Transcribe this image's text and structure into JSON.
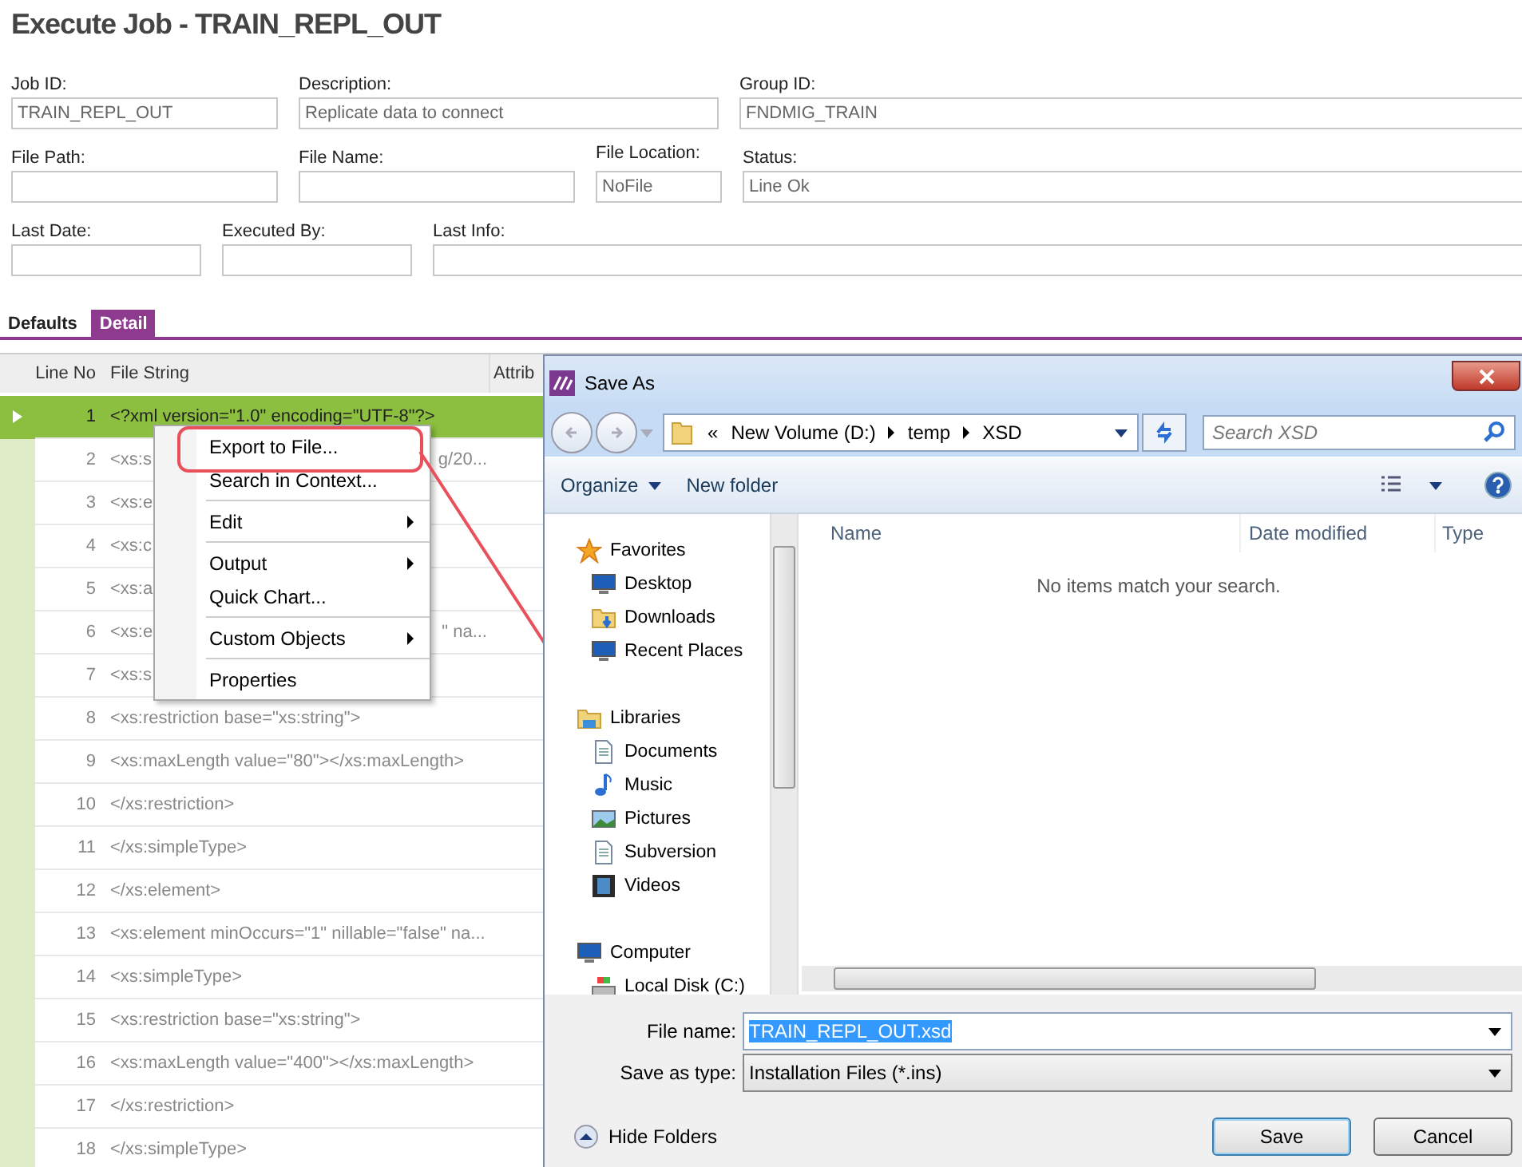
{
  "page": {
    "title": "Execute Job - TRAIN_REPL_OUT"
  },
  "form": {
    "fields": [
      {
        "label": "Job ID:",
        "value": "TRAIN_REPL_OUT"
      },
      {
        "label": "Description:",
        "value": "Replicate data to connect"
      },
      {
        "label": "Group ID:",
        "value": "FNDMIG_TRAIN"
      },
      {
        "label": "File Path:"
      },
      {
        "label": "File Name:"
      },
      {
        "label": "File Location:",
        "value": "NoFile"
      },
      {
        "label": "Status:",
        "value": "Line Ok"
      },
      {
        "label": "Last Date:"
      },
      {
        "label": "Executed By:"
      },
      {
        "label": "Last Info:"
      }
    ]
  },
  "tabs": [
    {
      "label": "Defaults",
      "selected": false
    },
    {
      "label": "Detail",
      "selected": true
    }
  ],
  "grid": {
    "columns": [
      "Line No",
      "File String",
      "Attrib"
    ],
    "rows": [
      {
        "line_no": "1",
        "file_string": "<?xml version=\"1.0\" encoding=\"UTF-8\"?>",
        "selected": true
      },
      {
        "line_no": "2",
        "file_string": "<xs:s",
        "file_string_tail": "g/20...",
        "selected": false
      },
      {
        "line_no": "3",
        "file_string": "<xs:e",
        "selected": false
      },
      {
        "line_no": "4",
        "file_string": "<xs:c",
        "selected": false
      },
      {
        "line_no": "5",
        "file_string": "<xs:a",
        "selected": false
      },
      {
        "line_no": "6",
        "file_string": "<xs:e",
        "file_string_tail": "\" na...",
        "selected": false
      },
      {
        "line_no": "7",
        "file_string": "<xs:s",
        "selected": false
      },
      {
        "line_no": "8",
        "file_string": "<xs:restriction base=\"xs:string\">",
        "selected": false
      },
      {
        "line_no": "9",
        "file_string": "<xs:maxLength value=\"80\"></xs:maxLength>",
        "selected": false
      },
      {
        "line_no": "10",
        "file_string": "</xs:restriction>",
        "selected": false
      },
      {
        "line_no": "11",
        "file_string": "</xs:simpleType>",
        "selected": false
      },
      {
        "line_no": "12",
        "file_string": "</xs:element>",
        "selected": false
      },
      {
        "line_no": "13",
        "file_string": "<xs:element minOccurs=\"1\" nillable=\"false\" na...",
        "selected": false
      },
      {
        "line_no": "14",
        "file_string": "<xs:simpleType>",
        "selected": false
      },
      {
        "line_no": "15",
        "file_string": "<xs:restriction base=\"xs:string\">",
        "selected": false
      },
      {
        "line_no": "16",
        "file_string": "<xs:maxLength value=\"400\"></xs:maxLength>",
        "selected": false
      },
      {
        "line_no": "17",
        "file_string": "</xs:restriction>",
        "selected": false
      },
      {
        "line_no": "18",
        "file_string": "</xs:simpleType>",
        "selected": false
      }
    ]
  },
  "context_menu": {
    "items": [
      {
        "kind": "item",
        "label": "Export to File...",
        "submenu": false
      },
      {
        "kind": "item",
        "label": "Search in Context...",
        "submenu": false
      },
      {
        "kind": "separator"
      },
      {
        "kind": "item",
        "label": "Edit",
        "submenu": true
      },
      {
        "kind": "separator"
      },
      {
        "kind": "item",
        "label": "Output",
        "submenu": true
      },
      {
        "kind": "item",
        "label": "Quick Chart...",
        "submenu": false
      },
      {
        "kind": "separator"
      },
      {
        "kind": "item",
        "label": "Custom Objects",
        "submenu": true
      },
      {
        "kind": "separator"
      },
      {
        "kind": "item",
        "label": "Properties",
        "submenu": false
      }
    ]
  },
  "dialog": {
    "title": "Save As",
    "breadcrumb": [
      "«",
      "New Volume (D:)",
      "temp",
      "XSD"
    ],
    "search": {
      "placeholder": "Search XSD"
    },
    "toolbar": [
      "Organize",
      "New folder"
    ],
    "nav": [
      {
        "label": "Favorites",
        "children": [
          {
            "label": "Desktop"
          },
          {
            "label": "Downloads"
          },
          {
            "label": "Recent Places"
          }
        ]
      },
      {
        "label": "Libraries",
        "children": [
          {
            "label": "Documents"
          },
          {
            "label": "Music"
          },
          {
            "label": "Pictures"
          },
          {
            "label": "Subversion"
          },
          {
            "label": "Videos"
          }
        ]
      },
      {
        "label": "Computer",
        "children": [
          {
            "label": "Local Disk (C:)"
          }
        ]
      }
    ],
    "columns": [
      "Name",
      "Date modified",
      "Type"
    ],
    "empty_message": "No items match your search.",
    "file_name": {
      "label": "File name:",
      "value": "TRAIN_REPL_OUT.xsd"
    },
    "save_type": {
      "label": "Save as type:",
      "value": "Installation Files (*.ins)"
    },
    "hide_folders": "Hide Folders",
    "buttons": [
      "Save",
      "Cancel"
    ]
  }
}
